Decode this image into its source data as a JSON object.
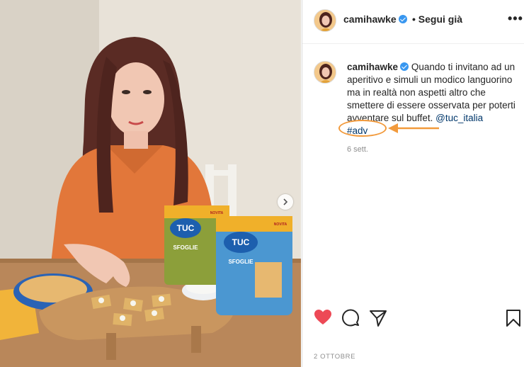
{
  "post": {
    "username": "camihawke",
    "follow_label": "• Segui già",
    "more_label": "•••",
    "caption_user": "camihawke",
    "caption_text": "Quando ti invitano ad un aperitivo e simuli un modico languorino ma in realtà non aspetti altro che smettere di essere osservata per poterti avventare sul buffet.",
    "caption_mention": "@tuc_italia",
    "caption_hashtag": "#adv",
    "relative_time": "6 sett.",
    "date": "2 OTTOBRE"
  },
  "photo": {
    "product_brand": "TUC",
    "product_name": "SFOGLIE",
    "product_badge": "NOVITA"
  },
  "colors": {
    "accent_orange": "#f29a3c",
    "like_red": "#ed4956",
    "link_blue": "#00376b",
    "verified_blue": "#3897f0"
  },
  "icons": {
    "like": "heart-icon",
    "comment": "comment-icon",
    "share": "paper-plane-icon",
    "save": "bookmark-icon",
    "next": "chevron-right-icon"
  }
}
